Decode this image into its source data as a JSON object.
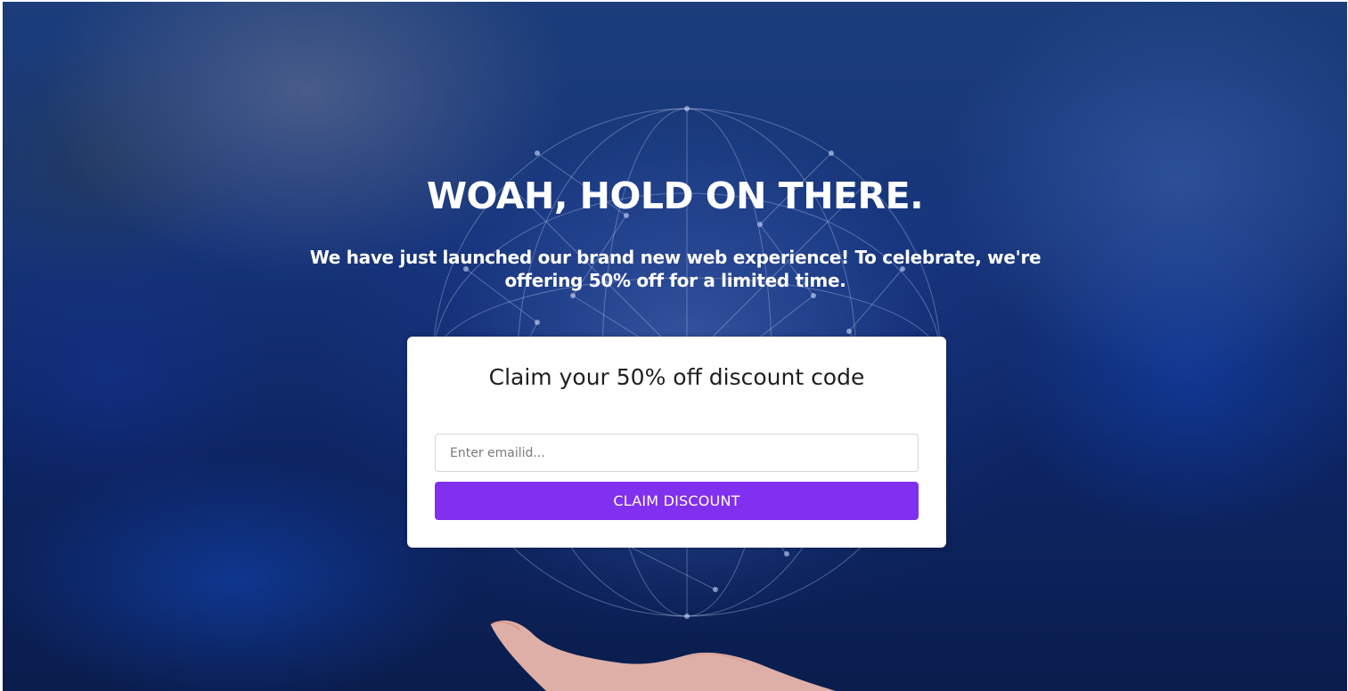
{
  "popup": {
    "headline": "WOAH, HOLD ON THERE.",
    "subtext": "We have just launched our brand new web experience! To celebrate, we're offering 50% off for a limited time."
  },
  "form": {
    "title": "Claim your 50% off discount code",
    "email_placeholder": "Enter emailid...",
    "email_value": "",
    "submit_label": "CLAIM DISCOUNT"
  },
  "colors": {
    "accent": "#8030ee",
    "card_background": "#ffffff",
    "page_background": "#16347a"
  },
  "icons": {
    "background_globe": "network-globe-icon",
    "background_hand": "open-hand-icon"
  }
}
